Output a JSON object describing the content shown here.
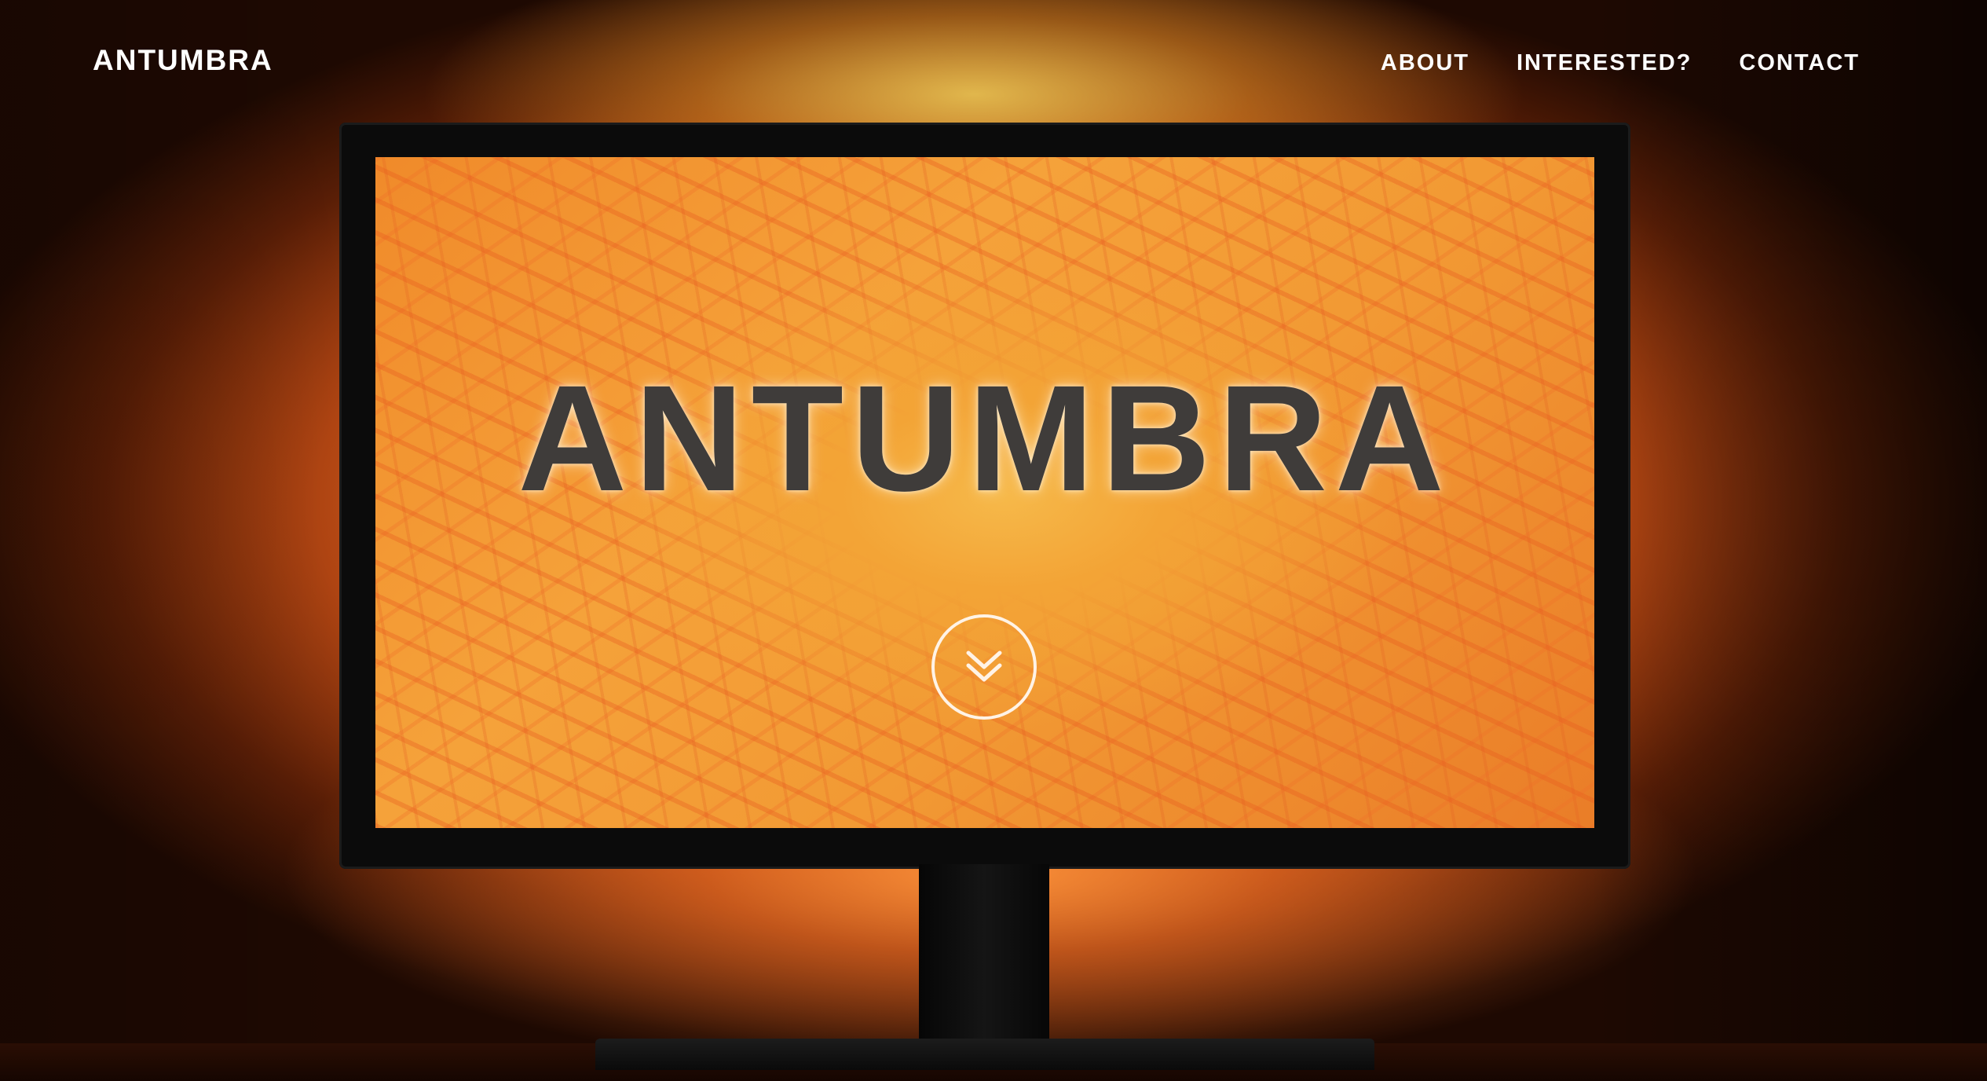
{
  "navbar": {
    "brand": "ANTUMBRA",
    "links": [
      {
        "label": "ABOUT"
      },
      {
        "label": "INTERESTED?"
      },
      {
        "label": "CONTACT"
      }
    ]
  },
  "hero": {
    "title": "ANTUMBRA",
    "scroll_icon": "double-chevron-down-icon"
  },
  "colors": {
    "accent_orange": "#f47a2c",
    "nav_text": "#ffffff",
    "title_text": "#3f3c3a"
  }
}
